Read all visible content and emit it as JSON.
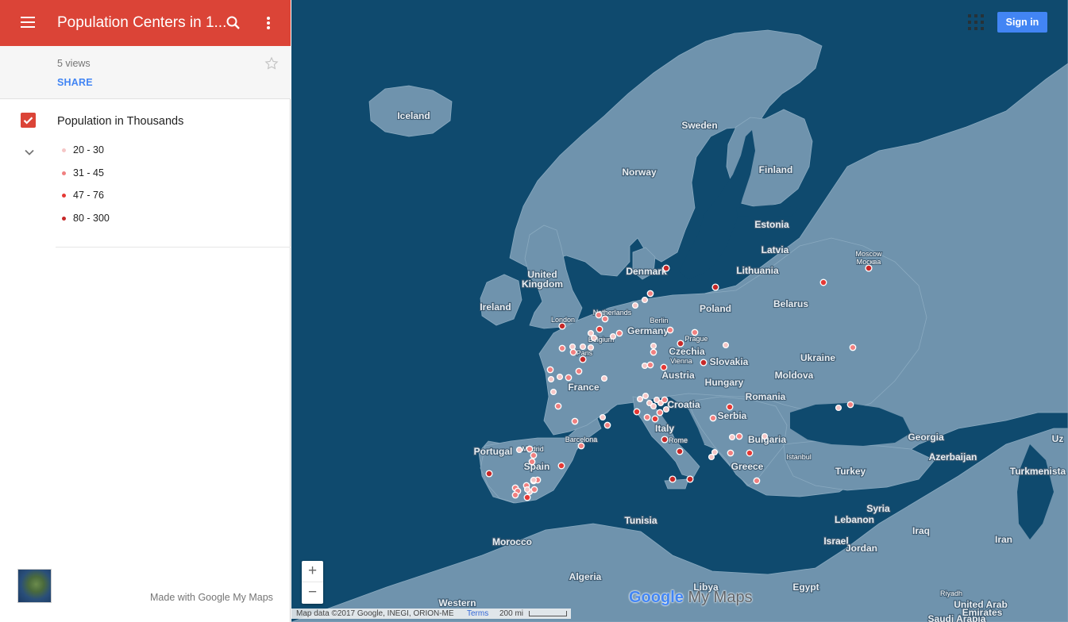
{
  "header": {
    "title": "Population Centers in 1...",
    "bg_color": "#db4437",
    "menu_icon": "hamburger-menu-icon",
    "search_icon": "search-icon",
    "more_icon": "more-vert-icon"
  },
  "info": {
    "views": "5 views",
    "share_label": "SHARE",
    "star_icon": "star-outline-icon"
  },
  "layer": {
    "title": "Population in Thousands",
    "checked": true,
    "legend": [
      {
        "label": "20 - 30",
        "color": "#f5c6c6"
      },
      {
        "label": "31 - 45",
        "color": "#f08080"
      },
      {
        "label": "47 - 76",
        "color": "#e53935"
      },
      {
        "label": "80 - 300",
        "color": "#c62828"
      }
    ]
  },
  "footer_left": {
    "made_with": "Made with Google My Maps"
  },
  "map": {
    "sign_in_label": "Sign in",
    "apps_icon": "apps-grid-icon",
    "zoom_in": "+",
    "zoom_out": "−",
    "logo": {
      "google": "Google",
      "mymaps": "My Maps"
    },
    "attribution": "Map data ©2017 Google, INEGI, ORION-ME",
    "terms": "Terms",
    "scale": "200 mi",
    "countries": [
      "Iceland",
      "Sweden",
      "Finland",
      "Norway",
      "Estonia",
      "Latvia",
      "Denmark",
      "Lithuania",
      "United",
      "Kingdom",
      "Ireland",
      "Poland",
      "Belarus",
      "Germany",
      "Czechia",
      "Slovakia",
      "Ukraine",
      "Moldova",
      "Austria",
      "Hungary",
      "France",
      "Romania",
      "Croatia",
      "Serbia",
      "Italy",
      "Bulgaria",
      "Georgia",
      "Azerbaijan",
      "Portugal",
      "Spain",
      "Greece",
      "Turkey",
      "Turkmenista",
      "Uz",
      "Syria",
      "Tunisia",
      "Lebanon",
      "Iraq",
      "Iran",
      "Morocco",
      "Israel",
      "Jordan",
      "Algeria",
      "Libya",
      "Egypt",
      "Saudi Arabia",
      "United Arab",
      "Emirates",
      "Western"
    ],
    "cities": [
      "Moscow",
      "Москва",
      "London",
      "Berlin",
      "Prague",
      "Vienna",
      "Paris",
      "Netherlands",
      "Belgium",
      "Barcelona",
      "Madrid",
      "Rome",
      "Istanbul",
      "Riyadh"
    ]
  }
}
